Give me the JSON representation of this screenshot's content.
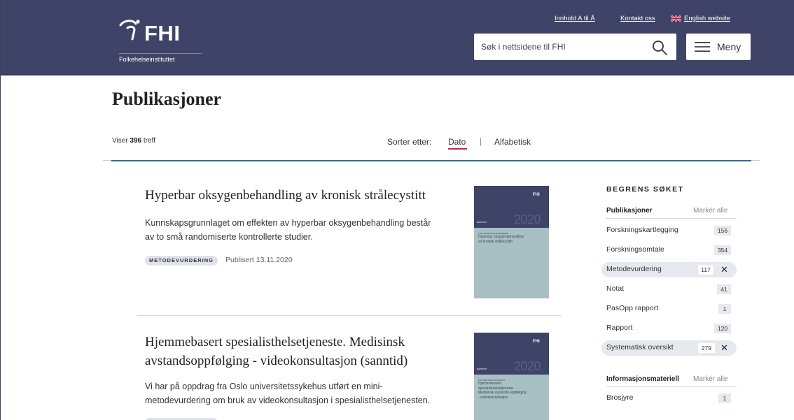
{
  "header": {
    "logo_text": "FHI",
    "logo_subtitle": "Folkehelseinstituttet",
    "links": {
      "az": "Innhold A til Å",
      "contact": "Kontakt oss",
      "english": "English website"
    },
    "search": {
      "placeholder": "Søk i nettsidene til FHI",
      "value": ""
    },
    "menu_label": "Meny",
    "colors": {
      "background": "#3f4367",
      "text": "#ffffff"
    }
  },
  "page": {
    "title": "Publikasjoner",
    "hits_prefix": "Viser",
    "hits_count": "396",
    "hits_suffix": "treff",
    "sort": {
      "label": "Sorter etter:",
      "options": [
        "Dato",
        "Alfabetisk"
      ],
      "active": "Dato",
      "separator": "|"
    },
    "accent_color": "#c9234a",
    "rule_color": "#2e6f91"
  },
  "results": [
    {
      "title": "Hyperbar oksygenbehandling av kronisk strålecystitt",
      "description_lines": [
        "Kunnskapsgrunnlaget om effekten av hyperbar oksygenbehandling består",
        "av to små randomiserte kontrollerte studier."
      ],
      "tag": "METODEVURDERING",
      "published": "Publisert 13.11.2020",
      "thumbnail": {
        "logo": "FHI",
        "year": "2020",
        "kicker": "RAPPORT",
        "small_tag": "KUNNSKAPSOPPSUMMERING",
        "text": "Hyperbar oksygenbehandling av kronisk strålecystitt"
      }
    },
    {
      "title_lines": [
        "Hjemmebasert spesialisthelsetjeneste. Medisinsk",
        "avstandsoppfølging - videokonsultasjon (sanntid)"
      ],
      "description_lines": [
        "Vi har på oppdrag fra Oslo universitetssykehus utført en mini-",
        "metodevurdering om bruk av videokonsultasjon i spesialisthelsetjenesten."
      ],
      "thumbnail": {
        "logo": "FHI",
        "year": "2020",
        "kicker": "RAPPORT",
        "small_tag": "MINI-METODEVURDERING",
        "text": "Hjemmebasert spesialisthelsetjeneste. Medisinsk avstands-oppfølging - videokonsultasjon"
      }
    }
  ],
  "sidebar": {
    "title": "BEGRENS SØKET",
    "groups": [
      {
        "heading": "Publikasjoner",
        "mark_all": "Markér alle",
        "items": [
          {
            "label": "Forskningskartlegging",
            "count": "156",
            "active": false
          },
          {
            "label": "Forskningsomtale",
            "count": "354",
            "active": false
          },
          {
            "label": "Metodevurdering",
            "count": "117",
            "active": true
          },
          {
            "label": "Notat",
            "count": "41",
            "active": false
          },
          {
            "label": "PasOpp rapport",
            "count": "1",
            "active": false
          },
          {
            "label": "Rapport",
            "count": "120",
            "active": false
          },
          {
            "label": "Systematisk oversikt",
            "count": "279",
            "active": true
          }
        ]
      },
      {
        "heading": "Informasjonsmateriell",
        "mark_all": "Markér alle",
        "items": [
          {
            "label": "Brosjyre",
            "count": "1",
            "active": false
          }
        ]
      }
    ],
    "remove_symbol": "✕"
  }
}
